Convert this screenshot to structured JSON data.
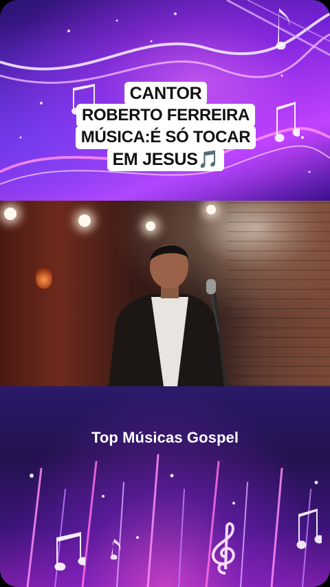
{
  "caption": {
    "line1": "CANTOR",
    "line2": "ROBERTO FERREIRA",
    "line3": "MÚSICA:É SÓ TOCAR",
    "line4": "EM JESUS🎵"
  },
  "footer": {
    "title": "Top Músicas Gospel"
  },
  "icons": {
    "music_note": "music-note-icon",
    "treble_clef": "treble-clef-icon"
  },
  "colors": {
    "accent_purple": "#6a1ed0",
    "accent_pink": "#c245ff"
  }
}
